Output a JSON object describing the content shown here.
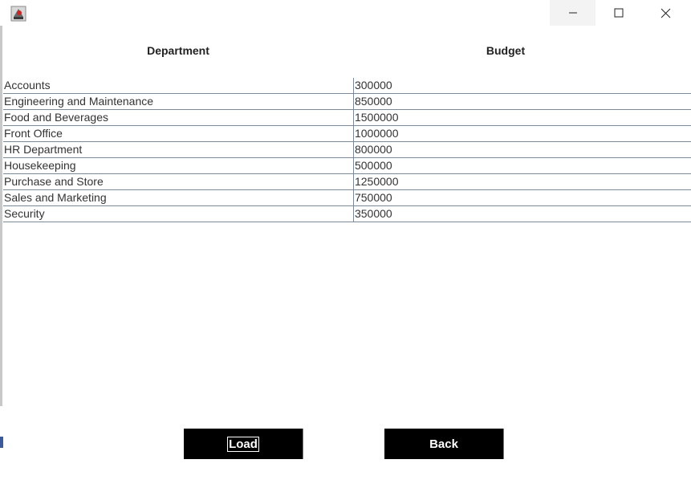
{
  "window": {
    "icon": "java-app-icon",
    "controls": [
      "minimize-icon",
      "maximize-icon",
      "close-icon"
    ]
  },
  "table": {
    "headers": {
      "department": "Department",
      "budget": "Budget"
    },
    "rows": [
      {
        "department": "Accounts",
        "budget": "300000"
      },
      {
        "department": "Engineering and Maintenance",
        "budget": "850000"
      },
      {
        "department": "Food and Beverages",
        "budget": "1500000"
      },
      {
        "department": "Front Office",
        "budget": "1000000"
      },
      {
        "department": "HR Department",
        "budget": "800000"
      },
      {
        "department": "Housekeeping",
        "budget": "500000"
      },
      {
        "department": "Purchase and Store",
        "budget": "1250000"
      },
      {
        "department": "Sales and Marketing",
        "budget": "750000"
      },
      {
        "department": "Security",
        "budget": "350000"
      }
    ]
  },
  "buttons": {
    "load": "Load",
    "back": "Back"
  },
  "colors": {
    "button_bg": "#000000",
    "button_text": "#ffffff",
    "grid_line": "#7a8a99"
  }
}
